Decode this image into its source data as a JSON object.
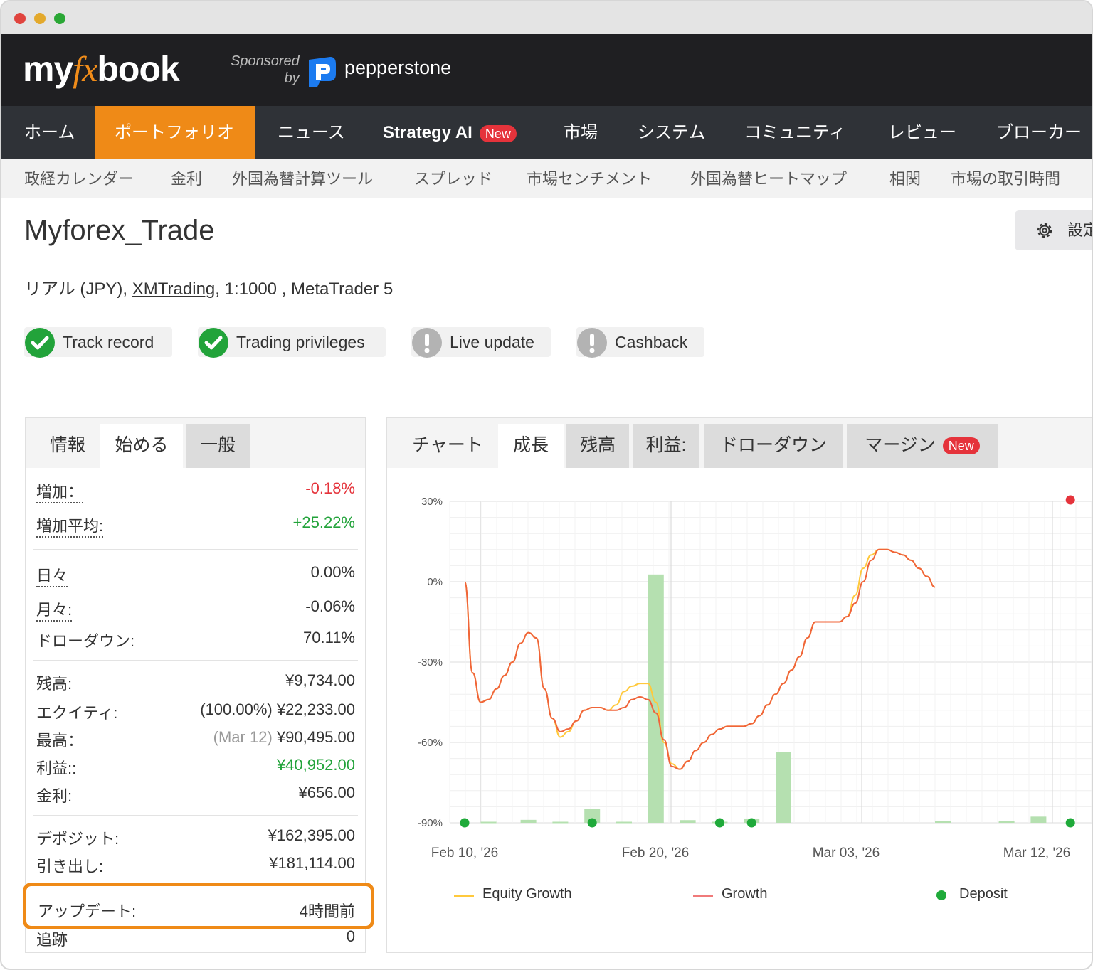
{
  "header": {
    "logo_my": "my",
    "logo_fx": "fx",
    "logo_book": "book",
    "sponsored_line1": "Sponsored",
    "sponsored_line2": "by",
    "sponsor_name": "pepperstone"
  },
  "main_nav": [
    {
      "label": "ホーム"
    },
    {
      "label": "ポートフォリオ",
      "active": true
    },
    {
      "label": "ニュース"
    },
    {
      "label": "Strategy AI",
      "badge": "New"
    },
    {
      "label": "市場"
    },
    {
      "label": "システム"
    },
    {
      "label": "コミュニティ"
    },
    {
      "label": "レビュー"
    },
    {
      "label": "ブローカー"
    }
  ],
  "sub_nav": [
    "政経カレンダー",
    "金利",
    "外国為替計算ツール",
    "スプレッド",
    "市場センチメント",
    "外国為替ヒートマップ",
    "相関",
    "市場の取引時間"
  ],
  "page": {
    "title": "Myforex_Trade",
    "settings_label": "設定",
    "account_prefix": "リアル (JPY),",
    "broker_link": "XMTrading",
    "account_suffix": ", 1:1000 , MetaTrader 5"
  },
  "status_pills": [
    {
      "label": "Track record",
      "icon": "check-circle-icon",
      "color": "#22a33a"
    },
    {
      "label": "Trading privileges",
      "icon": "check-circle-icon",
      "color": "#22a33a"
    },
    {
      "label": "Live update",
      "icon": "exclamation-circle-icon",
      "color": "#b3b3b3"
    },
    {
      "label": "Cashback",
      "icon": "exclamation-circle-icon",
      "color": "#b3b3b3"
    }
  ],
  "left_tabs": [
    "情報",
    "始める",
    "一般"
  ],
  "stats": {
    "gain_label": "増加：",
    "gain_value": "-0.18%",
    "avg_gain_label": "増加平均:",
    "avg_gain_value": "+25.22%",
    "daily_label": "日々",
    "daily_value": "0.00%",
    "monthly_label": "月々:",
    "monthly_value": "-0.06%",
    "drawdown_label": "ドローダウン:",
    "drawdown_value": "70.11%",
    "balance_label": "残高:",
    "balance_value": "¥9,734.00",
    "equity_label": "エクイティ:",
    "equity_pct": "(100.00%)",
    "equity_value": "¥22,233.00",
    "highest_label": "最高：",
    "highest_date": "(Mar 12)",
    "highest_value": "¥90,495.00",
    "profit_label": "利益::",
    "profit_value": "¥40,952.00",
    "interest_label": "金利:",
    "interest_value": "¥656.00",
    "deposits_label": "デポジット:",
    "deposits_value": "¥162,395.00",
    "withdrawals_label": "引き出し:",
    "withdrawals_value": "¥181,114.00",
    "updated_label": "アップデート:",
    "updated_value": "4時間前",
    "tracking_label": "追跡",
    "tracking_value": "0"
  },
  "right_tabs": [
    {
      "label": "チャート"
    },
    {
      "label": "成長"
    },
    {
      "label": "残高"
    },
    {
      "label": "利益:"
    },
    {
      "label": "ドローダウン"
    },
    {
      "label": "マージン",
      "badge": "New"
    }
  ],
  "colors": {
    "accent": "#ef8a17",
    "nav_bg": "#2f3237",
    "header_bg": "#1f1f22",
    "equity_line": "#ffc93c",
    "growth_line": "#f0643a",
    "deposit_dot": "#1faa3a",
    "bar": "#b5e0b0",
    "red_marker": "#e5333b"
  },
  "chart_data": {
    "type": "line",
    "y_ticks": [
      "30%",
      "0%",
      "-30%",
      "-60%",
      "-90%"
    ],
    "ylim": [
      -90,
      30
    ],
    "x_ticks": [
      "Feb 10, '26",
      "Feb 20, '26",
      "Mar 03, '26",
      "Mar 12, '26"
    ],
    "series": [
      {
        "name": "Equity Growth",
        "x": [
          0,
          1,
          2,
          3,
          4,
          5,
          6,
          7,
          8,
          9,
          10,
          11,
          12,
          13,
          14,
          15,
          16,
          17,
          18,
          19,
          20,
          21,
          22,
          23,
          24,
          25,
          26,
          27,
          28,
          29,
          30,
          31,
          32,
          33,
          34,
          35,
          36,
          37,
          38,
          39,
          40,
          41,
          42,
          43,
          44,
          45,
          46,
          47,
          48,
          49,
          50,
          51,
          52,
          53,
          54,
          55,
          56,
          57,
          58,
          59
        ],
        "y": [
          0,
          -34,
          -45,
          -44,
          -40,
          -35,
          -30,
          -23,
          -19,
          -21,
          -40,
          -51,
          -58,
          -56,
          -52,
          -48,
          -47,
          -47,
          -48,
          -46,
          -41,
          -39,
          -38,
          -38,
          -45,
          -60,
          -68,
          -70,
          -67,
          -63,
          -60,
          -57,
          -55,
          -54,
          -54,
          -54,
          -53,
          -50,
          -46,
          -42,
          -38,
          -33,
          -28,
          -21,
          -15,
          -15,
          -15,
          -15,
          -13,
          -5,
          5,
          10,
          12,
          12,
          11,
          10,
          8,
          5,
          2,
          -2
        ]
      },
      {
        "name": "Growth",
        "x": [
          0,
          1,
          2,
          3,
          4,
          5,
          6,
          7,
          8,
          9,
          10,
          11,
          12,
          13,
          14,
          15,
          16,
          17,
          18,
          19,
          20,
          21,
          22,
          23,
          24,
          25,
          26,
          27,
          28,
          29,
          30,
          31,
          32,
          33,
          34,
          35,
          36,
          37,
          38,
          39,
          40,
          41,
          42,
          43,
          44,
          45,
          46,
          47,
          48,
          49,
          50,
          51,
          52,
          53,
          54,
          55,
          56,
          57,
          58,
          59
        ],
        "y": [
          0,
          -34,
          -45,
          -44,
          -40,
          -35,
          -30,
          -23,
          -19,
          -21,
          -40,
          -51,
          -56,
          -55,
          -52,
          -48,
          -47,
          -47,
          -48,
          -48,
          -47,
          -44,
          -43,
          -44,
          -49,
          -59,
          -69,
          -70,
          -67,
          -63,
          -60,
          -57,
          -55,
          -54,
          -54,
          -54,
          -53,
          -50,
          -46,
          -42,
          -38,
          -33,
          -28,
          -21,
          -15,
          -15,
          -15,
          -15,
          -13,
          -8,
          0,
          8,
          12,
          12,
          11,
          10,
          8,
          5,
          2,
          -2
        ]
      }
    ],
    "bars": [
      {
        "x": 1.5,
        "value": -89.6
      },
      {
        "x": 4.0,
        "value": -88.9
      },
      {
        "x": 6.0,
        "value": -89.6
      },
      {
        "x": 8.0,
        "value": -84.8
      },
      {
        "x": 10.0,
        "value": -89.6
      },
      {
        "x": 12.0,
        "value": 2.7
      },
      {
        "x": 14.0,
        "value": -89.0
      },
      {
        "x": 16.0,
        "value": -89.6
      },
      {
        "x": 18.0,
        "value": -88.4
      },
      {
        "x": 20.0,
        "value": -63.6
      },
      {
        "x": 30.0,
        "value": -89.4
      },
      {
        "x": 34.0,
        "value": -89.4
      },
      {
        "x": 36.0,
        "value": -87.7
      }
    ],
    "deposits": [
      0,
      8.0,
      16.0,
      18.0,
      38.0
    ],
    "markers": [
      {
        "x": 38.0,
        "y": 30,
        "color": "#e5333b"
      }
    ],
    "legend": [
      "Equity Growth",
      "Growth",
      "Deposit"
    ],
    "grid": true,
    "legend_position": "bottom"
  }
}
